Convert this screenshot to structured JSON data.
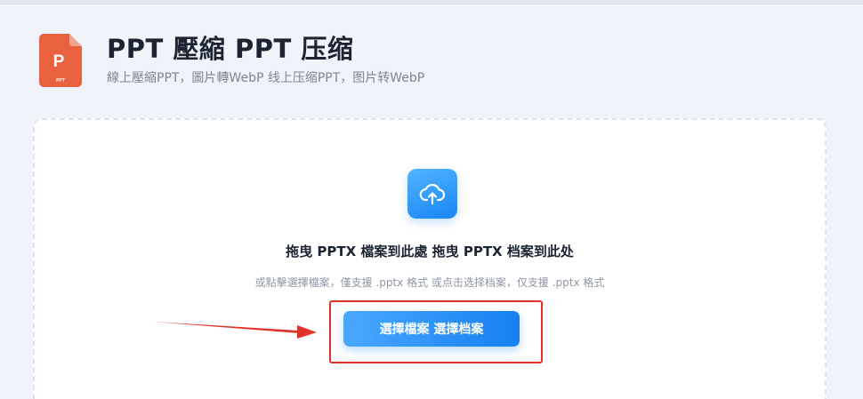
{
  "header": {
    "title": "PPT 壓縮 PPT 压缩",
    "subtitle": "線上壓縮PPT，圖片轉WebP 线上压缩PPT，图片转WebP",
    "file_icon_letter": "P",
    "file_icon_badge": "PPT"
  },
  "dropzone": {
    "title": "拖曳 PPTX 檔案到此處 拖曳 PPTX 档案到此处",
    "hint": "或點擊選擇檔案，僅支援 .pptx 格式 或点击选择档案，仅支援 .pptx 格式",
    "button_label": "選擇檔案 選擇档案"
  },
  "icons": {
    "file": "ppt-file-icon",
    "upload": "cloud-upload-icon",
    "annotation_arrow": "red-arrow-icon"
  },
  "colors": {
    "accent": "#1a86f5",
    "ppt_orange": "#e8623f",
    "annotation_red": "#e03228",
    "title_text": "#1c2331",
    "muted_text": "#7d8594"
  }
}
